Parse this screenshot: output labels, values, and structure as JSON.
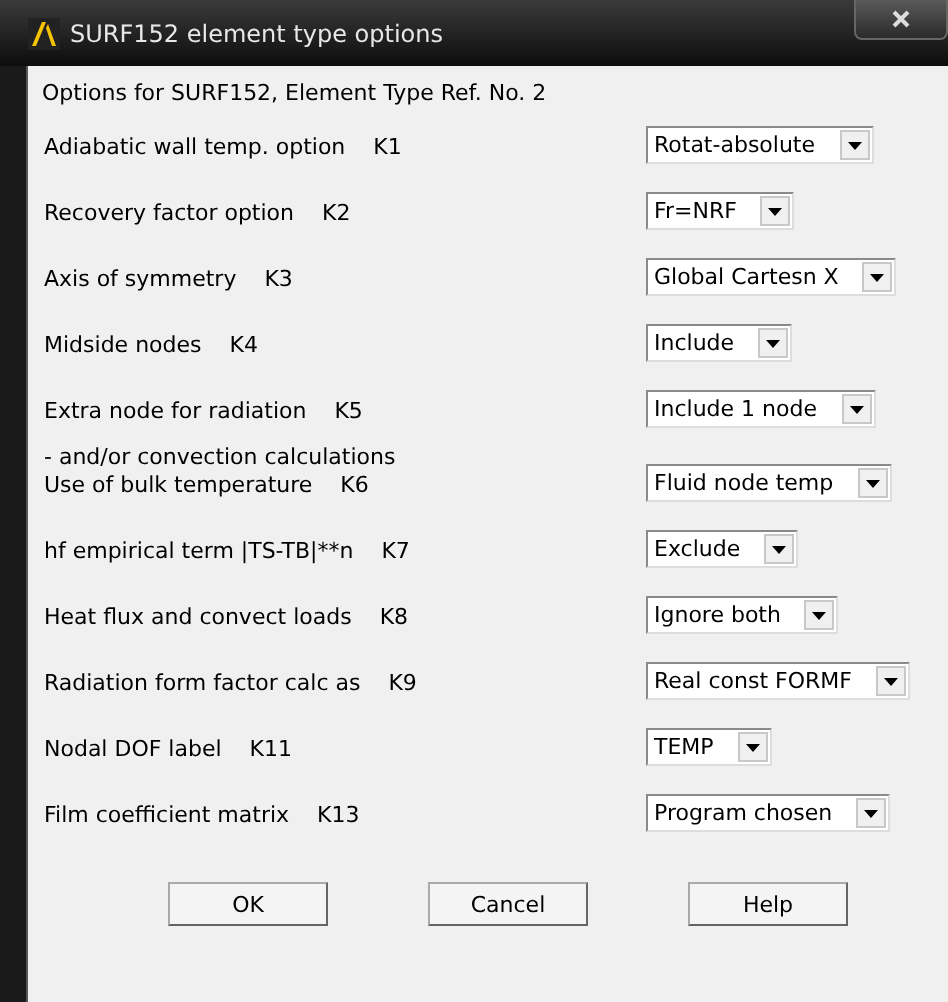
{
  "window": {
    "title": "SURF152 element type options"
  },
  "header": "Options for SURF152, Element Type Ref. No. 2",
  "options": [
    {
      "label": "Adiabatic wall temp. option",
      "key": "K1",
      "value": "Rotat-absolute"
    },
    {
      "label": "Recovery factor option",
      "key": "K2",
      "value": "Fr=NRF"
    },
    {
      "label": "Axis of symmetry",
      "key": "K3",
      "value": "Global Cartesn X"
    },
    {
      "label": "Midside nodes",
      "key": "K4",
      "value": "Include"
    },
    {
      "label": "Extra node for radiation",
      "key": "K5",
      "value": "Include 1 node",
      "note": "- and/or convection calculations"
    },
    {
      "label": "Use of bulk temperature",
      "key": "K6",
      "value": "Fluid node temp"
    },
    {
      "label": "hf empirical term |TS-TB|**n",
      "key": "K7",
      "value": "Exclude"
    },
    {
      "label": "Heat flux and convect loads",
      "key": "K8",
      "value": "Ignore both"
    },
    {
      "label": "Radiation form factor calc as",
      "key": "K9",
      "value": "Real const FORMF"
    },
    {
      "label": "Nodal DOF label",
      "key": "K11",
      "value": "TEMP"
    },
    {
      "label": "Film coefficient matrix",
      "key": "K13",
      "value": "Program chosen"
    }
  ],
  "buttons": [
    "OK",
    "Cancel",
    "Help"
  ]
}
